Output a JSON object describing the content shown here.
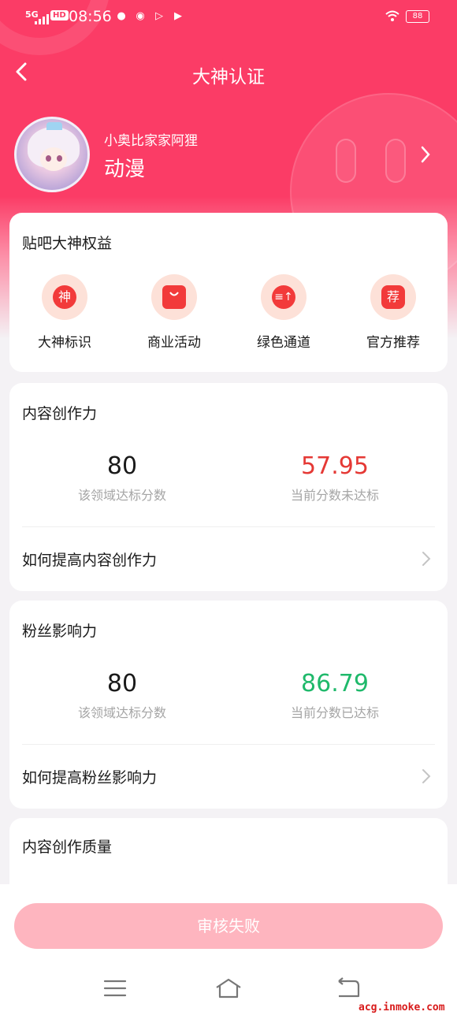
{
  "status_bar": {
    "network": "5G",
    "hd": "HD",
    "time": "08:56",
    "battery": "88",
    "app_icons": [
      "weibo-icon",
      "weibo-icon",
      "play-icon",
      "video-icon"
    ]
  },
  "nav": {
    "title": "大神认证"
  },
  "profile": {
    "name": "小奥比家家阿狸",
    "domain": "动漫"
  },
  "benefits": {
    "title": "贴吧大神权益",
    "items": [
      {
        "label": "大神标识",
        "glyph": "神",
        "icon": "shen-badge-icon"
      },
      {
        "label": "商业活动",
        "glyph": "",
        "icon": "shopping-bag-icon"
      },
      {
        "label": "绿色通道",
        "glyph": "≡↑",
        "icon": "fast-lane-icon"
      },
      {
        "label": "官方推荐",
        "glyph": "荐",
        "icon": "recommend-badge-icon"
      }
    ]
  },
  "content_creation": {
    "title": "内容创作力",
    "target_value": "80",
    "target_label": "该领域达标分数",
    "current_value": "57.95",
    "current_label": "当前分数未达标",
    "link": "如何提高内容创作力"
  },
  "fan_influence": {
    "title": "粉丝影响力",
    "target_value": "80",
    "target_label": "该领域达标分数",
    "current_value": "86.79",
    "current_label": "当前分数已达标",
    "link": "如何提高粉丝影响力"
  },
  "content_quality": {
    "title": "内容创作质量"
  },
  "action": {
    "label": "审核失败"
  },
  "watermark": "acg.inmoke.com",
  "colors": {
    "brand": "#fb3c66",
    "fail": "#e53935",
    "pass": "#1fb96b",
    "button_disabled": "#feb5bf"
  }
}
